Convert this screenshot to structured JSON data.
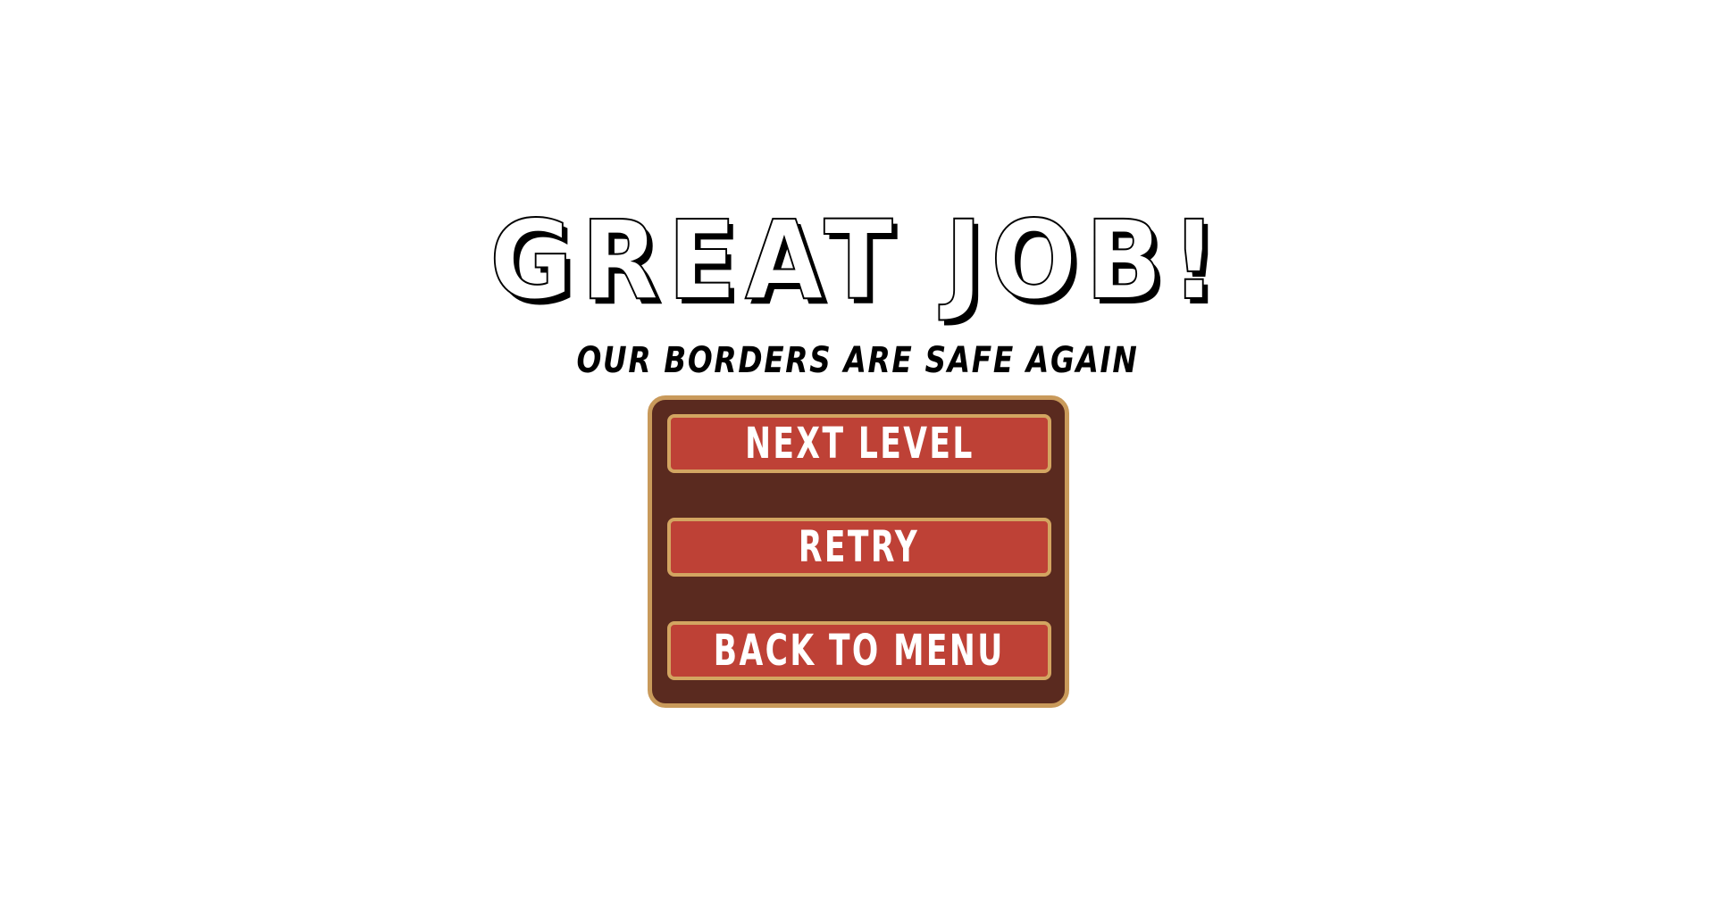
{
  "result": {
    "title": "GREAT JOB!",
    "subtitle": "OUR BORDERS ARE SAFE AGAIN"
  },
  "menu": {
    "buttons": [
      {
        "label": "NEXT LEVEL"
      },
      {
        "label": "RETRY"
      },
      {
        "label": "BACK TO MENU"
      }
    ]
  },
  "colors": {
    "panel_background": "#5a2a1f",
    "panel_border": "#c99a5b",
    "button_background": "#be4136",
    "button_border": "#d3a561",
    "button_text": "#ffffff",
    "title_outline": "#000000"
  }
}
